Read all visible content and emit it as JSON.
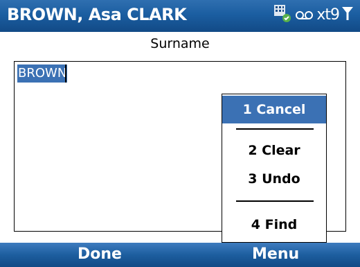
{
  "window": {
    "title": "BROWN, Asa CLARK"
  },
  "status": {
    "xt9_label": "xt9",
    "icons": [
      "data-icon",
      "voicemail-icon",
      "signal-icon"
    ]
  },
  "field": {
    "label": "Surname",
    "value": "BROWN"
  },
  "menu": {
    "items": [
      {
        "label": "1 Cancel",
        "selected": true
      },
      {
        "label": "2 Clear",
        "selected": false
      },
      {
        "label": "3 Undo",
        "selected": false
      },
      {
        "label": "4 Find",
        "selected": false
      }
    ]
  },
  "softkeys": {
    "left": "Done",
    "right": "Menu"
  },
  "colors": {
    "titlebar": "#1b5ea1",
    "selection": "#3b71b4"
  }
}
